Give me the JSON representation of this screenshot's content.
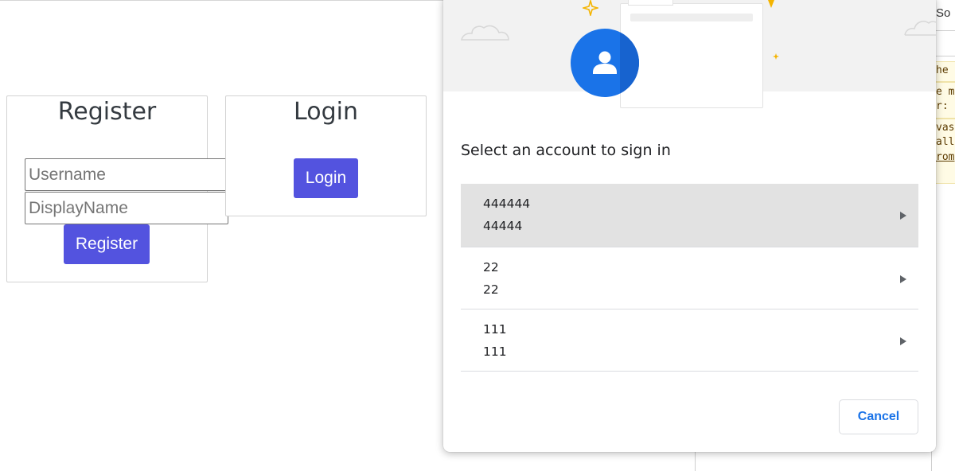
{
  "page": {
    "register": {
      "title": "Register",
      "username_placeholder": "Username",
      "displayname_placeholder": "DisplayName",
      "button_label": "Register"
    },
    "login": {
      "title": "Login",
      "button_label": "Login"
    }
  },
  "devtools": {
    "tab_label": "So",
    "lines": [
      "he",
      "e m",
      "r:",
      "vas",
      "all",
      "rom"
    ]
  },
  "dialog": {
    "title": "Select an account to sign in",
    "accounts": [
      {
        "name": "444444",
        "email": "44444"
      },
      {
        "name": "22",
        "email": "22"
      },
      {
        "name": "111",
        "email": "111"
      }
    ],
    "cancel_label": "Cancel",
    "icons": {
      "avatar": "person-icon",
      "row_chevron": "chevron-right-icon"
    },
    "colors": {
      "accent": "#1a73e8",
      "selected_row": "#e2e2e2",
      "hero_background": "#f2f2f2"
    }
  },
  "colors": {
    "primary_button": "#5353df"
  }
}
